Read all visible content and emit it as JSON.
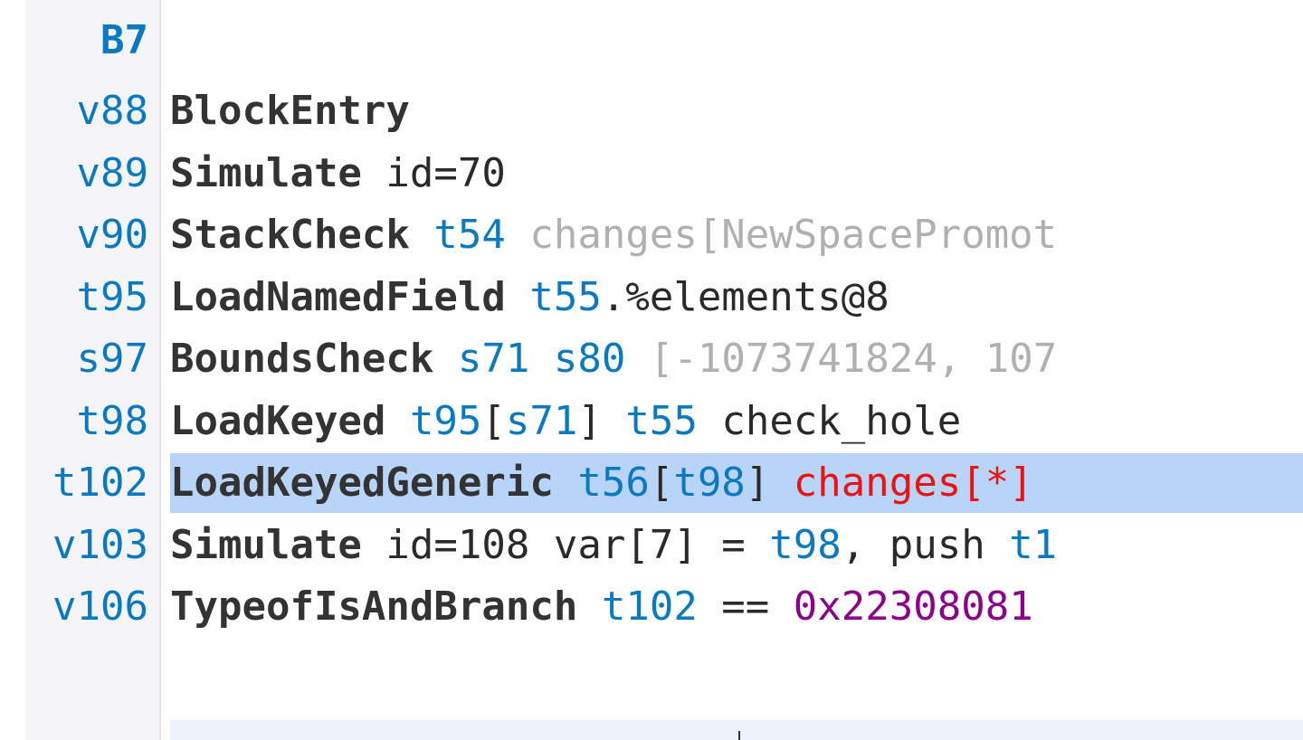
{
  "block": {
    "label": "B7"
  },
  "rows": [
    {
      "num": "v88",
      "op": "BlockEntry",
      "rest": []
    },
    {
      "num": "v89",
      "op": "Simulate",
      "rest": [
        {
          "t": " id=70",
          "c": "plain"
        }
      ]
    },
    {
      "num": "v90",
      "op": "StackCheck",
      "rest": [
        {
          "t": " ",
          "c": "plain"
        },
        {
          "t": "t54",
          "c": "ref"
        },
        {
          "t": " changes[NewSpacePromot",
          "c": "dim"
        }
      ]
    },
    {
      "num": "t95",
      "op": "LoadNamedField",
      "rest": [
        {
          "t": " ",
          "c": "plain"
        },
        {
          "t": "t55",
          "c": "ref"
        },
        {
          "t": ".%elements@8",
          "c": "plain"
        }
      ]
    },
    {
      "num": "s97",
      "op": "BoundsCheck",
      "rest": [
        {
          "t": " ",
          "c": "plain"
        },
        {
          "t": "s71",
          "c": "ref"
        },
        {
          "t": " ",
          "c": "plain"
        },
        {
          "t": "s80",
          "c": "ref"
        },
        {
          "t": " [-1073741824, 107",
          "c": "dim"
        }
      ]
    },
    {
      "num": "t98",
      "op": "LoadKeyed",
      "rest": [
        {
          "t": " ",
          "c": "plain"
        },
        {
          "t": "t95",
          "c": "ref"
        },
        {
          "t": "[",
          "c": "plain"
        },
        {
          "t": "s71",
          "c": "ref"
        },
        {
          "t": "] ",
          "c": "plain"
        },
        {
          "t": "t55",
          "c": "ref"
        },
        {
          "t": " check_hole",
          "c": "plain"
        }
      ]
    },
    {
      "num": "t102",
      "op": "LoadKeyedGeneric",
      "highlight": true,
      "rest": [
        {
          "t": " ",
          "c": "plain"
        },
        {
          "t": "t56",
          "c": "ref"
        },
        {
          "t": "[",
          "c": "plain"
        },
        {
          "t": "t98",
          "c": "ref"
        },
        {
          "t": "] ",
          "c": "plain"
        },
        {
          "t": "changes[*]",
          "c": "red"
        }
      ]
    },
    {
      "num": "v103",
      "op": "Simulate",
      "rest": [
        {
          "t": " id=108 var[7] = ",
          "c": "plain"
        },
        {
          "t": "t98",
          "c": "ref"
        },
        {
          "t": ", push ",
          "c": "plain"
        },
        {
          "t": "t1",
          "c": "ref"
        }
      ]
    },
    {
      "num": "v106",
      "op": "TypeofIsAndBranch",
      "rest": [
        {
          "t": " ",
          "c": "plain"
        },
        {
          "t": "t102",
          "c": "ref"
        },
        {
          "t": " == ",
          "c": "plain"
        },
        {
          "t": "0x22308081",
          "c": "purple"
        }
      ]
    }
  ]
}
